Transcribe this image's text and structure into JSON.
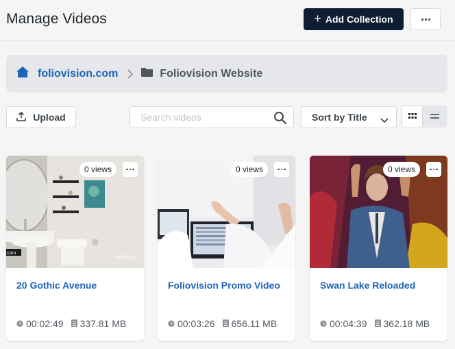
{
  "header": {
    "title": "Manage Videos",
    "add_collection_label": "Add Collection",
    "add_icon": "+"
  },
  "breadcrumb": {
    "home_label": "foliovision.com",
    "folder_label": "Foliovision Website"
  },
  "toolbar": {
    "upload_label": "Upload",
    "search_placeholder": "Search videos",
    "sort_label": "Sort by Title",
    "active_view": "grid"
  },
  "videos": [
    {
      "title": "20 Gothic Avenue",
      "views": "0 views",
      "duration": "00:02:49",
      "size": "337.81 MB"
    },
    {
      "title": "Foliovision Promo Video",
      "views": "0 views",
      "duration": "00:03:26",
      "size": "656.11 MB"
    },
    {
      "title": "Swan Lake Reloaded",
      "views": "0 views",
      "duration": "00:04:39",
      "size": "362.18 MB"
    }
  ],
  "thumbnail_texts": {
    "sothebys_watermark": "Sotheby's",
    "corner_label": "com"
  },
  "colors": {
    "primary_button": "#0f1d33",
    "link_blue": "#1d64b9",
    "background": "#f5f5f6"
  }
}
